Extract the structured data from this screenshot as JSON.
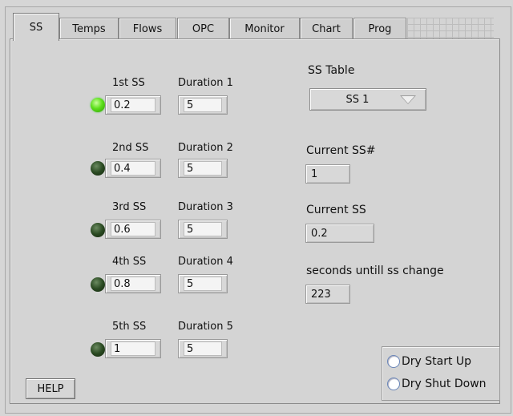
{
  "tabs": [
    {
      "label": "SS",
      "active": true
    },
    {
      "label": "Temps"
    },
    {
      "label": "Flows"
    },
    {
      "label": "OPC"
    },
    {
      "label": "Monitor"
    },
    {
      "label": "Chart"
    },
    {
      "label": "Prog"
    }
  ],
  "ss_rows": [
    {
      "ss_label": "1st SS",
      "ss_value": "0.2",
      "dur_label": "Duration 1",
      "dur_value": "5",
      "led": "on"
    },
    {
      "ss_label": "2nd SS",
      "ss_value": "0.4",
      "dur_label": "Duration 2",
      "dur_value": "5",
      "led": "off"
    },
    {
      "ss_label": "3rd SS",
      "ss_value": "0.6",
      "dur_label": "Duration 3",
      "dur_value": "5",
      "led": "off"
    },
    {
      "ss_label": "4th SS",
      "ss_value": "0.8",
      "dur_label": "Duration 4",
      "dur_value": "5",
      "led": "off"
    },
    {
      "ss_label": "5th SS",
      "ss_value": "1",
      "dur_label": "Duration 5",
      "dur_value": "5",
      "led": "off"
    }
  ],
  "ss_table": {
    "label": "SS Table",
    "selected": "SS 1"
  },
  "current_ss_num": {
    "label": "Current SS#",
    "value": "1"
  },
  "current_ss": {
    "label": "Current SS",
    "value": "0.2"
  },
  "seconds_change": {
    "label": "seconds untill ss change",
    "value": "223"
  },
  "radios": {
    "dry_start": "Dry Start Up",
    "dry_shutdown": "Dry Shut Down"
  },
  "help_label": "HELP",
  "colors": {
    "led_on": "#5ee01c",
    "led_off": "#2a4a22",
    "background": "#d4d4d4"
  }
}
